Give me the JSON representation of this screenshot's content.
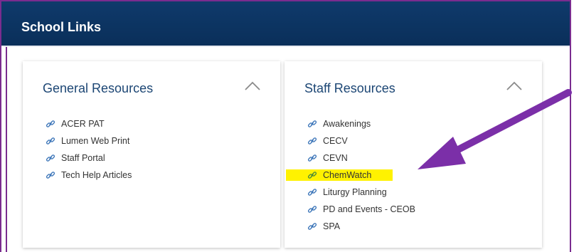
{
  "header": {
    "title": "School Links"
  },
  "cards": [
    {
      "title": "General Resources",
      "links": [
        "ACER PAT",
        "Lumen Web Print",
        "Staff Portal",
        "Tech Help Articles"
      ]
    },
    {
      "title": "Staff Resources",
      "links": [
        "Awakenings",
        "CECV",
        "CEVN",
        "ChemWatch",
        "Liturgy Planning",
        "PD and Events - CEOB",
        "SPA"
      ]
    }
  ],
  "highlight": {
    "link": "ChemWatch",
    "color": "#fff200"
  },
  "colors": {
    "header": "#0f3a6b",
    "accent": "#7a2c8f",
    "link_icon": "#3a74b8",
    "card_title": "#1c4674"
  },
  "icons": {
    "link": "link-icon",
    "collapse": "chevron-up-icon",
    "annotation": "arrow-annotation"
  }
}
